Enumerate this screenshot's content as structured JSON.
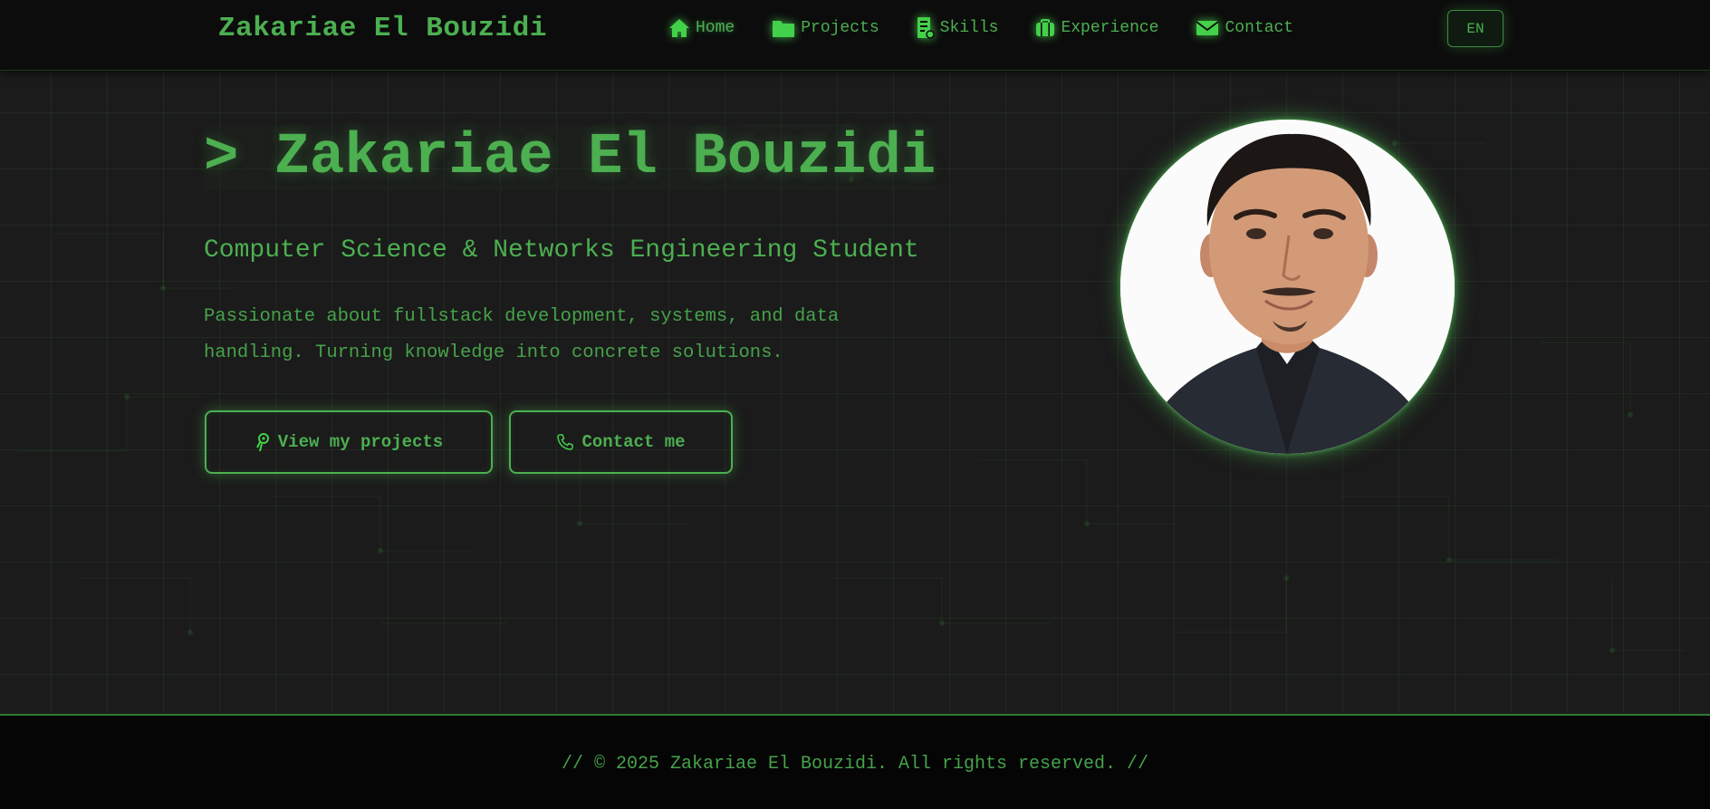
{
  "navbar": {
    "brand": "Zakariae El Bouzidi",
    "items": [
      {
        "label": "Home",
        "icon": "home-icon"
      },
      {
        "label": "Projects",
        "icon": "folder-icon"
      },
      {
        "label": "Skills",
        "icon": "skills-icon"
      },
      {
        "label": "Experience",
        "icon": "briefcase-icon"
      },
      {
        "label": "Contact",
        "icon": "mail-icon"
      }
    ],
    "language": "EN"
  },
  "hero": {
    "prompt": ">",
    "name": "Zakariae El Bouzidi",
    "subtitle": "Computer Science & Networks Engineering Student",
    "description": "Passionate about fullstack development, systems, and data handling. Turning knowledge into concrete solutions.",
    "buttons": {
      "projects": "View my projects",
      "contact": "Contact me"
    }
  },
  "footer": {
    "text": "// © 2025 Zakariae El Bouzidi. All rights reserved. //"
  },
  "colors": {
    "accent": "#4caf50",
    "background": "#1a1a1a",
    "navbar": "#0c0c0c",
    "footer": "#050505"
  }
}
